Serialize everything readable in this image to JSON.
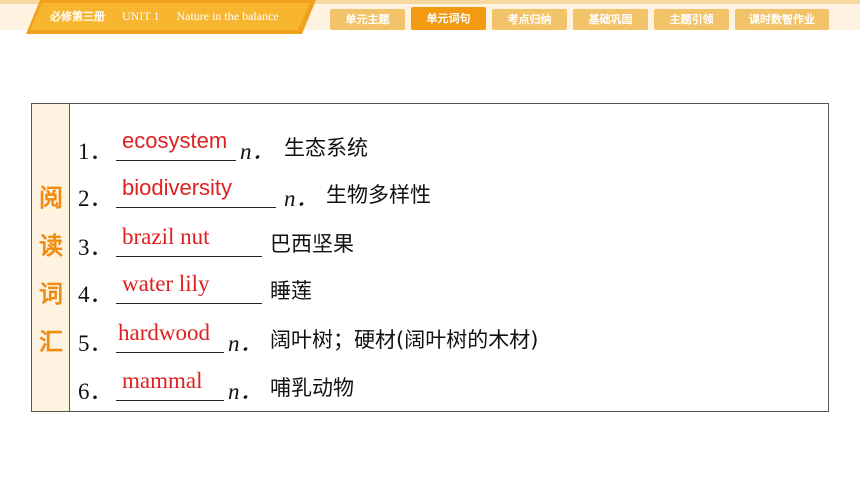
{
  "header": {
    "book": "必修第三册",
    "unit": "UNIT 1",
    "unit_title": "Nature in the balance"
  },
  "nav": {
    "tabs": [
      {
        "label": "单元主题",
        "active": false
      },
      {
        "label": "单元词句",
        "active": true
      },
      {
        "label": "考点归纳",
        "active": false
      },
      {
        "label": "基础巩固",
        "active": false
      },
      {
        "label": "主题引领",
        "active": false
      },
      {
        "label": "课时数智作业",
        "active": false
      }
    ]
  },
  "section_label": [
    "阅",
    "读",
    "词",
    "汇"
  ],
  "vocab": [
    {
      "num": "1．",
      "answer": "ecosystem",
      "pos": "n．",
      "meaning": "生态系统"
    },
    {
      "num": "2．",
      "answer": "biodiversity",
      "pos": "n．",
      "meaning": "生物多样性"
    },
    {
      "num": "3．",
      "answer": "brazil nut",
      "pos": "",
      "meaning": "巴西坚果"
    },
    {
      "num": "4．",
      "answer": "water lily",
      "pos": "",
      "meaning": "睡莲"
    },
    {
      "num": "5．",
      "answer": "hardwood",
      "pos": "n．",
      "meaning": "阔叶树；硬材(阔叶树的木材)"
    },
    {
      "num": "6．",
      "answer": "mammal",
      "pos": "n．",
      "meaning": "哺乳动物"
    }
  ],
  "colors": {
    "accent": "#f0a21c",
    "answer": "#e02020",
    "label": "#f08c10"
  }
}
